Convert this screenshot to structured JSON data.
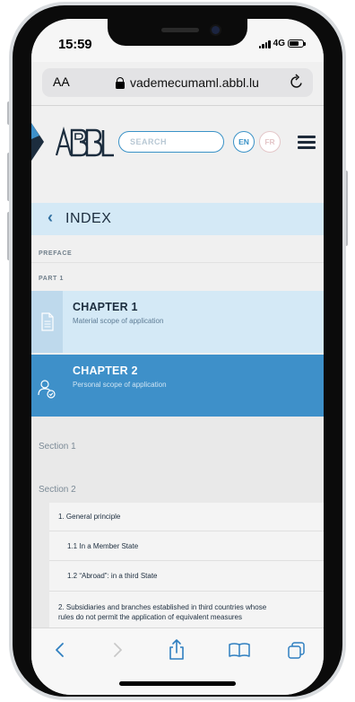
{
  "status_bar": {
    "time": "15:59",
    "network": "4G"
  },
  "browser": {
    "text_size_label": "AA",
    "url": "vademecumaml.abbl.lu"
  },
  "header": {
    "search_placeholder": "SEARCH",
    "lang_en": "EN",
    "lang_fr": "FR"
  },
  "index": {
    "label": "INDEX"
  },
  "nav": {
    "preface": "PREFACE",
    "part": "PART 1"
  },
  "chapters": [
    {
      "title": "CHAPTER 1",
      "subtitle": "Material scope of application"
    },
    {
      "title": "CHAPTER 2",
      "subtitle": "Personal scope of application"
    }
  ],
  "sections": [
    {
      "label": "Section 1"
    },
    {
      "label": "Section 2"
    }
  ],
  "sub_items": [
    {
      "label": "1. General principle"
    },
    {
      "label": "1.1 In a Member State"
    },
    {
      "label": "1.2 “Abroad”: in a third State"
    },
    {
      "label": "2. Subsidiaries and branches established in third countries whose"
    },
    {
      "label": "rules do not permit the application of equivalent measures"
    }
  ],
  "colors": {
    "accent": "#3e90c9",
    "light_accent": "#d4e9f6",
    "ink": "#1c2d3e"
  }
}
